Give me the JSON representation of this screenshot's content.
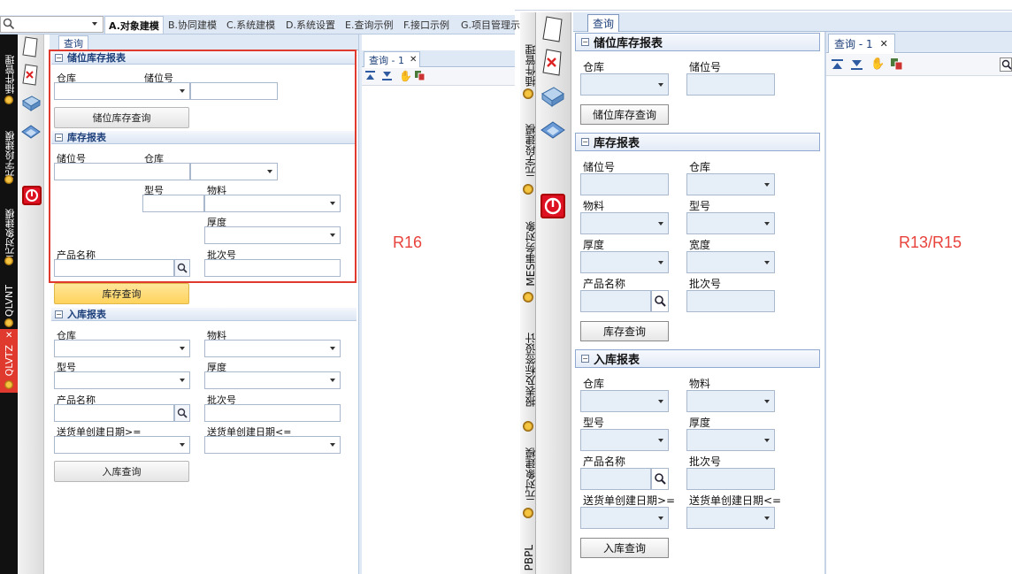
{
  "left": {
    "search": {
      "placeholder": ""
    },
    "top_tabs": [
      "A.对象建模",
      "B.协同建模",
      "C.系统建模",
      "D.系统设置",
      "E.查询示例",
      "F.接口示例",
      "G.项目管理示"
    ],
    "side_labels": [
      "插件管理",
      "元字段建模",
      "元对象建模",
      "QLVNT",
      "QLVTZ"
    ],
    "side_close": "✕",
    "query_tab": "查询",
    "result_tab": "查询 - 1",
    "close_x": "✕",
    "sec1": {
      "title": "储位库存报表",
      "warehouse": "仓库",
      "location": "储位号",
      "button": "储位库存查询"
    },
    "sec2": {
      "title": "库存报表",
      "location": "储位号",
      "warehouse": "仓库",
      "model": "型号",
      "material": "物料",
      "thickness": "厚度",
      "product": "产品名称",
      "batch": "批次号",
      "button": "库存查询"
    },
    "sec3": {
      "title": "入库报表",
      "warehouse": "仓库",
      "material": "物料",
      "model": "型号",
      "thickness": "厚度",
      "product": "产品名称",
      "batch": "批次号",
      "date_from": "送货单创建日期>=",
      "date_to": "送货单创建日期<=",
      "button": "入库查询"
    },
    "annotation": "R16"
  },
  "right": {
    "side_labels": [
      "插件管理",
      "元字段建模",
      "MES事务对象",
      "报表及标签设计",
      "元对象建模",
      "PBPL"
    ],
    "query_tab": "查询",
    "result_tab": "查询 - 1",
    "close_x": "✕",
    "sec1": {
      "title": "储位库存报表",
      "warehouse": "仓库",
      "location": "储位号",
      "button": "储位库存查询"
    },
    "sec2": {
      "title": "库存报表",
      "location": "储位号",
      "warehouse": "仓库",
      "material": "物料",
      "model": "型号",
      "thickness": "厚度",
      "width": "宽度",
      "product": "产品名称",
      "batch": "批次号",
      "button": "库存查询"
    },
    "sec3": {
      "title": "入库报表",
      "warehouse": "仓库",
      "material": "物料",
      "model": "型号",
      "thickness": "厚度",
      "product": "产品名称",
      "batch": "批次号",
      "date_from": "送货单创建日期>=",
      "date_to": "送货单创建日期<=",
      "button": "入库查询"
    },
    "annotation": "R13/R15"
  },
  "colors": {
    "accent_red": "#e03a2e",
    "annotation": "#e8423c",
    "highlight": "#ffd35c"
  }
}
